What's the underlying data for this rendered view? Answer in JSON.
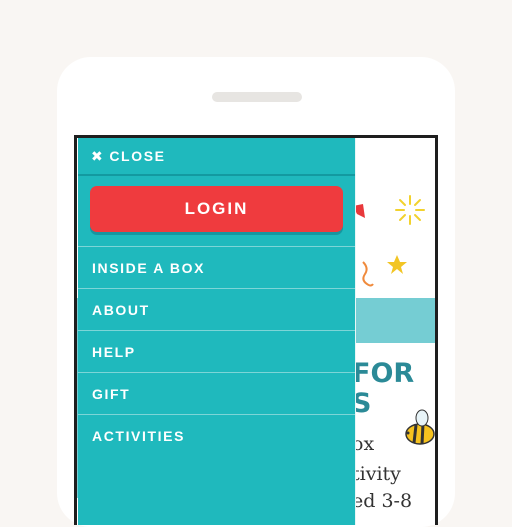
{
  "menu": {
    "close_label": "CLOSE",
    "close_icon": "✖",
    "login_label": "LOGIN",
    "items": [
      {
        "label": "INSIDE A BOX"
      },
      {
        "label": "ABOUT"
      },
      {
        "label": "HELP"
      },
      {
        "label": "GIFT"
      },
      {
        "label": "ACTIVITIES"
      }
    ]
  },
  "background_page": {
    "headline_line1": "FOR",
    "headline_line2": "S",
    "text_line1": "ox",
    "text_line2": "tivity",
    "text_line3": "ed 3-8"
  },
  "colors": {
    "drawer": "#1fb9bd",
    "login_button": "#ef3b3e",
    "page_background": "#f9f6f3"
  }
}
